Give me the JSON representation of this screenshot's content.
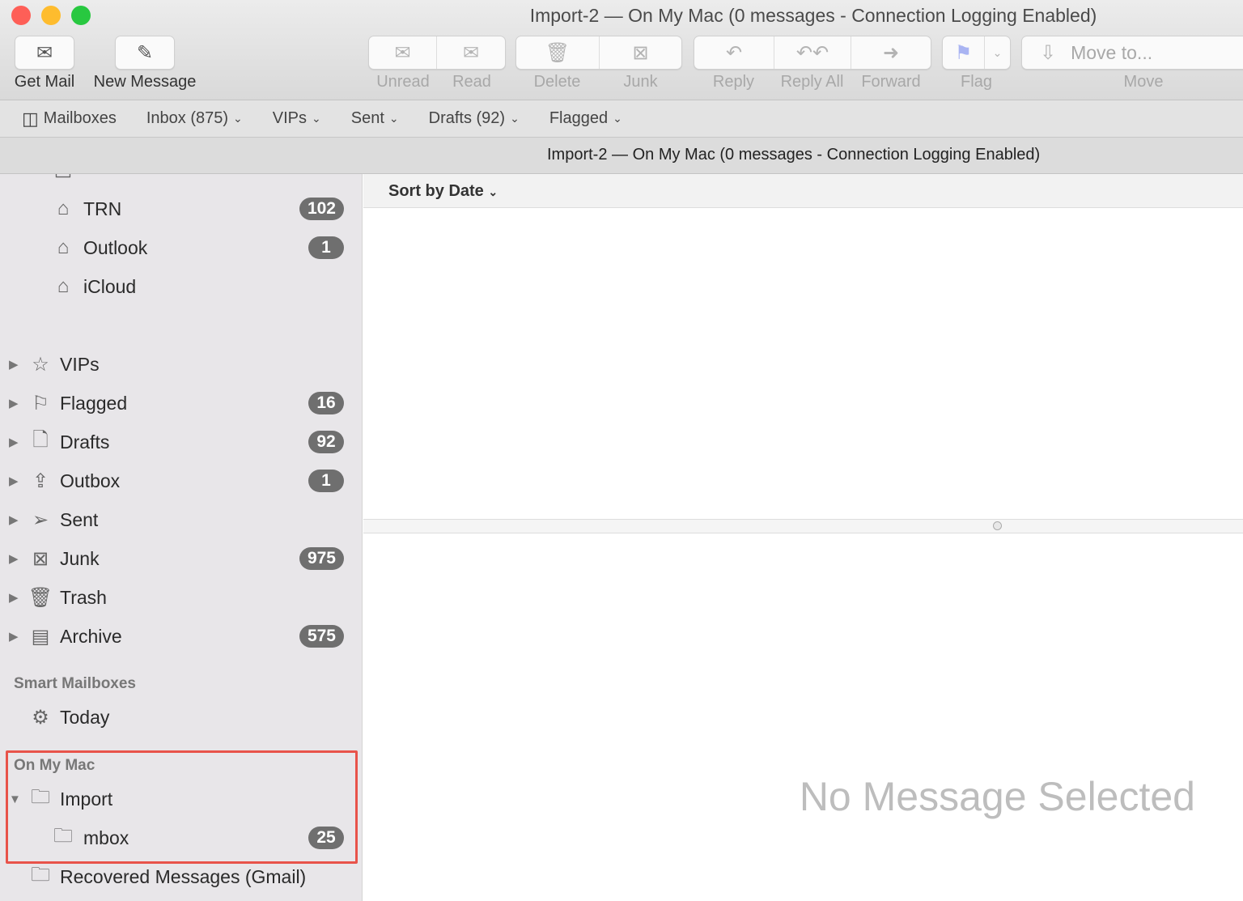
{
  "window": {
    "title": "Import-2 — On My Mac (0 messages - Connection Logging Enabled)",
    "colors": {
      "close": "#fe5f57",
      "minimize": "#febc2e",
      "zoom": "#28c840",
      "highlight": "#e8534a",
      "flag": "#a9b4f2"
    }
  },
  "toolbar": {
    "get_mail": "Get Mail",
    "new_message": "New Message",
    "unread": "Unread",
    "read": "Read",
    "delete": "Delete",
    "junk": "Junk",
    "reply": "Reply",
    "reply_all": "Reply All",
    "forward": "Forward",
    "flag": "Flag",
    "move_to": "Move to...",
    "move": "Move"
  },
  "favorites": {
    "mailboxes": "Mailboxes",
    "items": [
      "Inbox (875)",
      "VIPs",
      "Sent",
      "Drafts (92)",
      "Flagged"
    ]
  },
  "list": {
    "title": "Import-2 — On My Mac (0 messages - Connection Logging Enabled)",
    "sort": "Sort by Date"
  },
  "sidebar": {
    "accounts": [
      {
        "label": "TRN",
        "count": "102"
      },
      {
        "label": "Outlook",
        "count": "1"
      },
      {
        "label": "iCloud",
        "count": ""
      }
    ],
    "mailboxes": [
      {
        "label": "VIPs",
        "icon": "star-icon",
        "count": ""
      },
      {
        "label": "Flagged",
        "icon": "flag-icon",
        "count": "16"
      },
      {
        "label": "Drafts",
        "icon": "drafts-icon",
        "count": "92"
      },
      {
        "label": "Outbox",
        "icon": "outbox-icon",
        "count": "1"
      },
      {
        "label": "Sent",
        "icon": "paper-plane-icon",
        "count": ""
      },
      {
        "label": "Junk",
        "icon": "junk-icon",
        "count": "975"
      },
      {
        "label": "Trash",
        "icon": "trash-icon",
        "count": ""
      },
      {
        "label": "Archive",
        "icon": "archive-icon",
        "count": "575"
      }
    ],
    "smart_header": "Smart Mailboxes",
    "today": "Today",
    "onmymac_header": "On My Mac",
    "import": "Import",
    "mbox": "mbox",
    "mbox_count": "25",
    "recovered": "Recovered Messages (Gmail)"
  },
  "viewer": {
    "empty": "No Message Selected"
  }
}
